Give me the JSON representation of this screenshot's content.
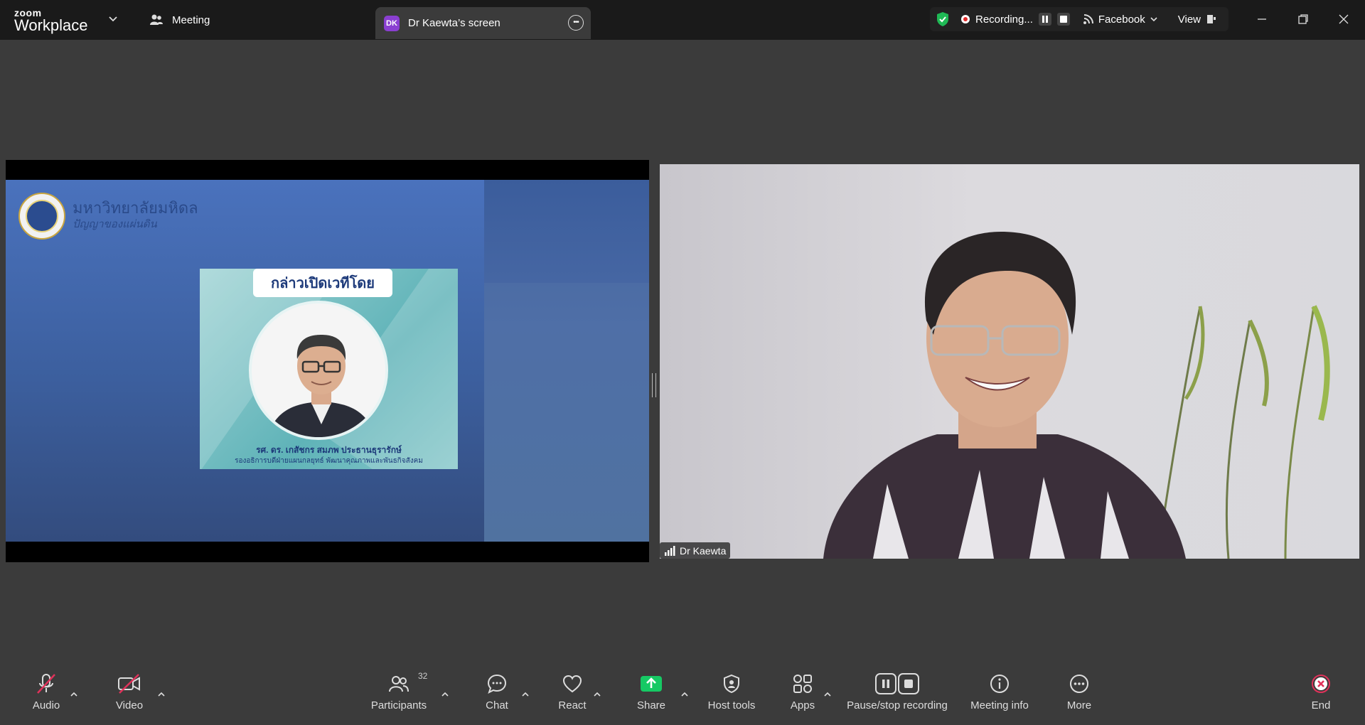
{
  "app": {
    "brand_top": "zoom",
    "brand_bottom": "Workplace"
  },
  "tabs": {
    "meeting_label": "Meeting",
    "screen_avatar": "DK",
    "screen_label": "Dr Kaewta’s screen"
  },
  "recording_bar": {
    "status": "Recording...",
    "stream_target": "Facebook",
    "view_label": "View",
    "status_color": "#1fb955",
    "record_color": "#e02828"
  },
  "shared_screen": {
    "university_name": "มหาวิทยาลัยมหิดล",
    "university_motto": "ปัญญาของแผ่นดิน",
    "card_title": "กล่าวเปิดเวทีโดย",
    "speaker_name": "รศ. ดร. เกสัชกร สมภพ ประธานธุรารักษ์",
    "speaker_role": "รองอธิการบดีฝ่ายแผนกลยุทธ์ พัฒนาคุณภาพและพันธกิจสังคม"
  },
  "video": {
    "participant_name": "Dr Kaewta"
  },
  "toolbar": {
    "audio": "Audio",
    "video": "Video",
    "participants": "Participants",
    "participants_count": "32",
    "chat": "Chat",
    "react": "React",
    "share": "Share",
    "host_tools": "Host tools",
    "apps": "Apps",
    "pause_stop": "Pause/stop recording",
    "meeting_info": "Meeting info",
    "more": "More",
    "end": "End",
    "share_color": "#16c964",
    "end_color": "#e0325a"
  }
}
